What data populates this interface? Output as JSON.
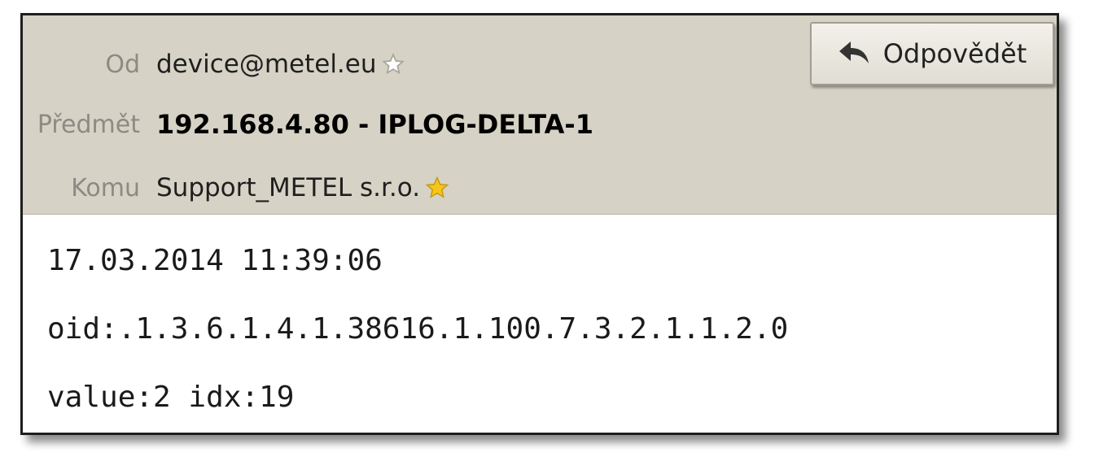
{
  "header": {
    "from": {
      "label": "Od",
      "value": "device@metel.eu",
      "star_icon": "star-outline-icon"
    },
    "subject": {
      "label": "Předmět",
      "value": "192.168.4.80 - IPLOG-DELTA-1"
    },
    "to": {
      "label": "Komu",
      "value": "Support_METEL s.r.o.",
      "star_icon": "star-filled-icon"
    },
    "reply_button": {
      "label": "Odpovědět",
      "icon": "reply-arrow-icon"
    }
  },
  "message": {
    "lines": [
      "17.03.2014 11:39:06",
      "oid:.1.3.6.1.4.1.38616.1.100.7.3.2.1.1.2.0",
      "value:2 idx:19"
    ]
  },
  "colors": {
    "header_bg": "#d6d2c5",
    "label_gray": "#8d8a84",
    "star_gold": "#f5c518"
  }
}
